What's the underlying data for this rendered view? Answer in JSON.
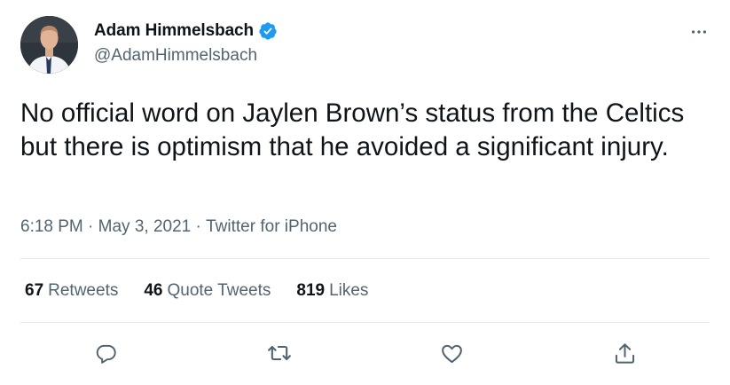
{
  "author": {
    "display_name": "Adam Himmelsbach",
    "handle": "@AdamHimmelsbach",
    "verified": true
  },
  "tweet": {
    "text": "No official word on Jaylen Brown’s status from the Celtics but there is optimism that he avoided a significant injury.",
    "time": "6:18 PM",
    "separator": " · ",
    "date": "May 3, 2021",
    "source": "Twitter for iPhone"
  },
  "stats": {
    "retweets_count": "67",
    "retweets_label": "Retweets",
    "quote_count": "46",
    "quote_label": "Quote Tweets",
    "likes_count": "819",
    "likes_label": "Likes"
  },
  "icons": {
    "more": "more-horizontal-icon",
    "verified": "verified-badge-icon",
    "reply": "reply-icon",
    "retweet": "retweet-icon",
    "like": "heart-icon",
    "share": "share-icon"
  },
  "colors": {
    "text_primary": "#0f1419",
    "text_secondary": "#536471",
    "verified_blue": "#1d9bf0",
    "divider": "#e1e8ed"
  }
}
